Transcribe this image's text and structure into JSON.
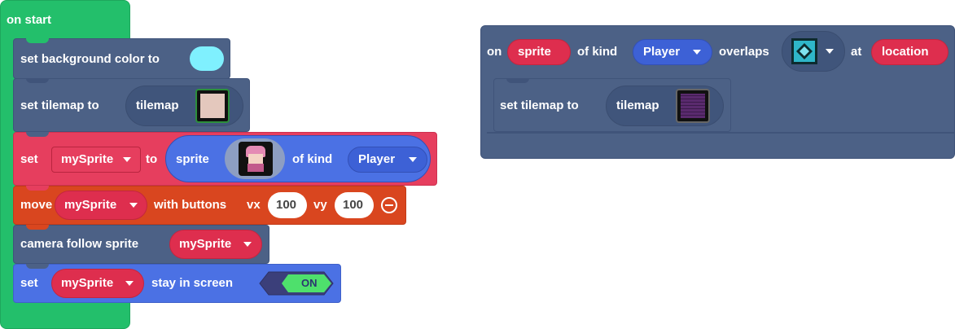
{
  "on_start": {
    "hat_label": "on start",
    "set_bg": {
      "label": "set background color to",
      "color": "#7ff0fe"
    },
    "set_tilemap": {
      "label": "set tilemap to",
      "field": "tilemap"
    },
    "set_sprite": {
      "set": "set",
      "var": "mySprite",
      "to": "to",
      "sprite": "sprite",
      "of_kind": "of kind",
      "kind": "Player"
    },
    "move": {
      "label": "move",
      "var": "mySprite",
      "with_buttons": "with buttons",
      "vx_label": "vx",
      "vx": "100",
      "vy_label": "vy",
      "vy": "100"
    },
    "camera": {
      "label": "camera follow sprite",
      "var": "mySprite"
    },
    "stay": {
      "set": "set",
      "var": "mySprite",
      "stay": "stay in screen",
      "toggle": "ON"
    }
  },
  "overlap_event": {
    "on": "on",
    "sprite": "sprite",
    "of_kind": "of kind",
    "kind": "Player",
    "overlaps": "overlaps",
    "at": "at",
    "location": "location",
    "set_tilemap": {
      "label": "set tilemap to",
      "field": "tilemap"
    }
  },
  "colors": {
    "hat": "#23bf6b",
    "scene": "#4c6186",
    "sprites": "#e63e5e",
    "controller": "#d9461f",
    "sprites_blue": "#4b71e4"
  },
  "icons": [
    "color-swatch-icon",
    "tilemap-thumbnail-icon",
    "sprite-image-icon",
    "tile-image-icon",
    "dropdown-arrow-icon",
    "remove-minus-icon",
    "toggle-switch-icon"
  ]
}
